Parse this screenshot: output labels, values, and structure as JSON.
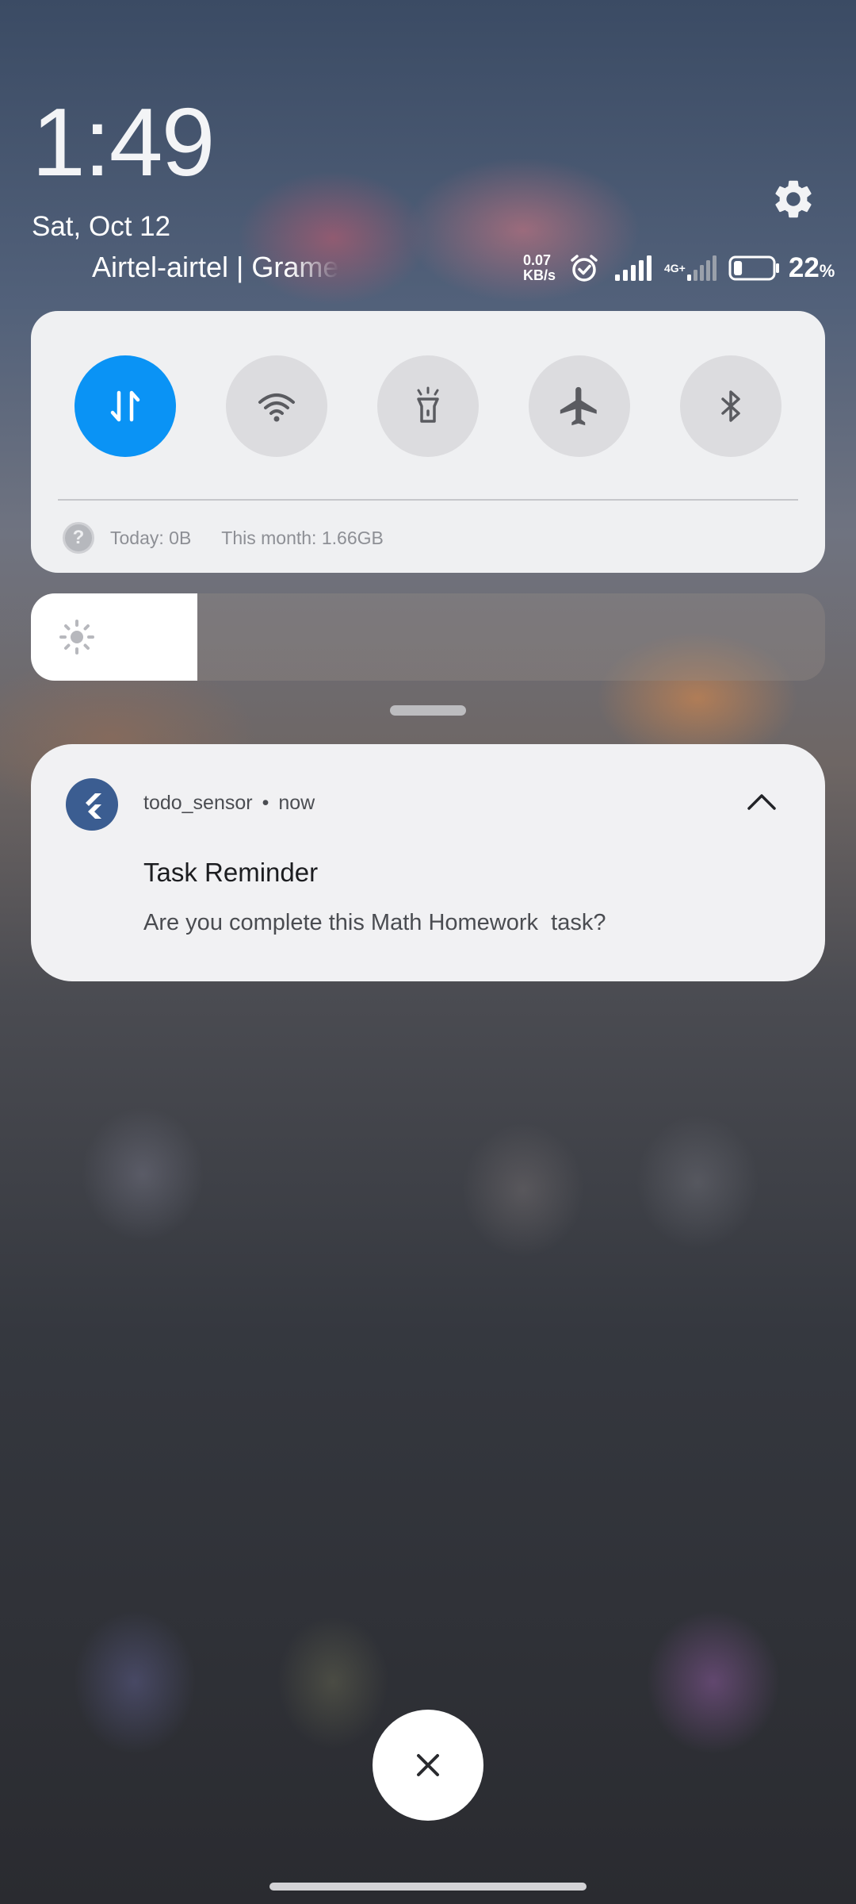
{
  "lockscreen": {
    "time": "1:49",
    "date": "Sat, Oct 12",
    "carrier": "Airtel-airtel | Grameenphone"
  },
  "status_bar": {
    "net_speed_value": "0.07",
    "net_speed_unit": "KB/s",
    "network_type": "4G+",
    "battery_percent": "22",
    "battery_unit": "%",
    "battery_level": 0.22,
    "icons": [
      "alarm-icon",
      "signal-icon",
      "signal-icon",
      "battery-icon",
      "settings-icon"
    ]
  },
  "quick_settings": {
    "toggles": [
      {
        "name": "mobile-data",
        "icon": "data-transfer-icon",
        "active": true
      },
      {
        "name": "wifi",
        "icon": "wifi-icon",
        "active": false
      },
      {
        "name": "flashlight",
        "icon": "flashlight-icon",
        "active": false
      },
      {
        "name": "airplane-mode",
        "icon": "airplane-icon",
        "active": false
      },
      {
        "name": "bluetooth",
        "icon": "bluetooth-icon",
        "active": false
      }
    ],
    "data_usage": {
      "help_icon": "?",
      "today": "Today: 0B",
      "month": "This month: 1.66GB"
    }
  },
  "brightness": {
    "level": 0.21,
    "icon": "sun-icon"
  },
  "notification": {
    "app_name": "todo_sensor",
    "separator": "•",
    "time": "now",
    "title": "Task Reminder",
    "body": "Are you complete this Math Homework  task?",
    "expand_icon": "chevron-up-icon"
  },
  "controls": {
    "dismiss_icon": "close-icon"
  },
  "colors": {
    "accent": "#0a93f5",
    "panel": "#eff0f2",
    "app_icon_bg": "#3b5d91"
  }
}
